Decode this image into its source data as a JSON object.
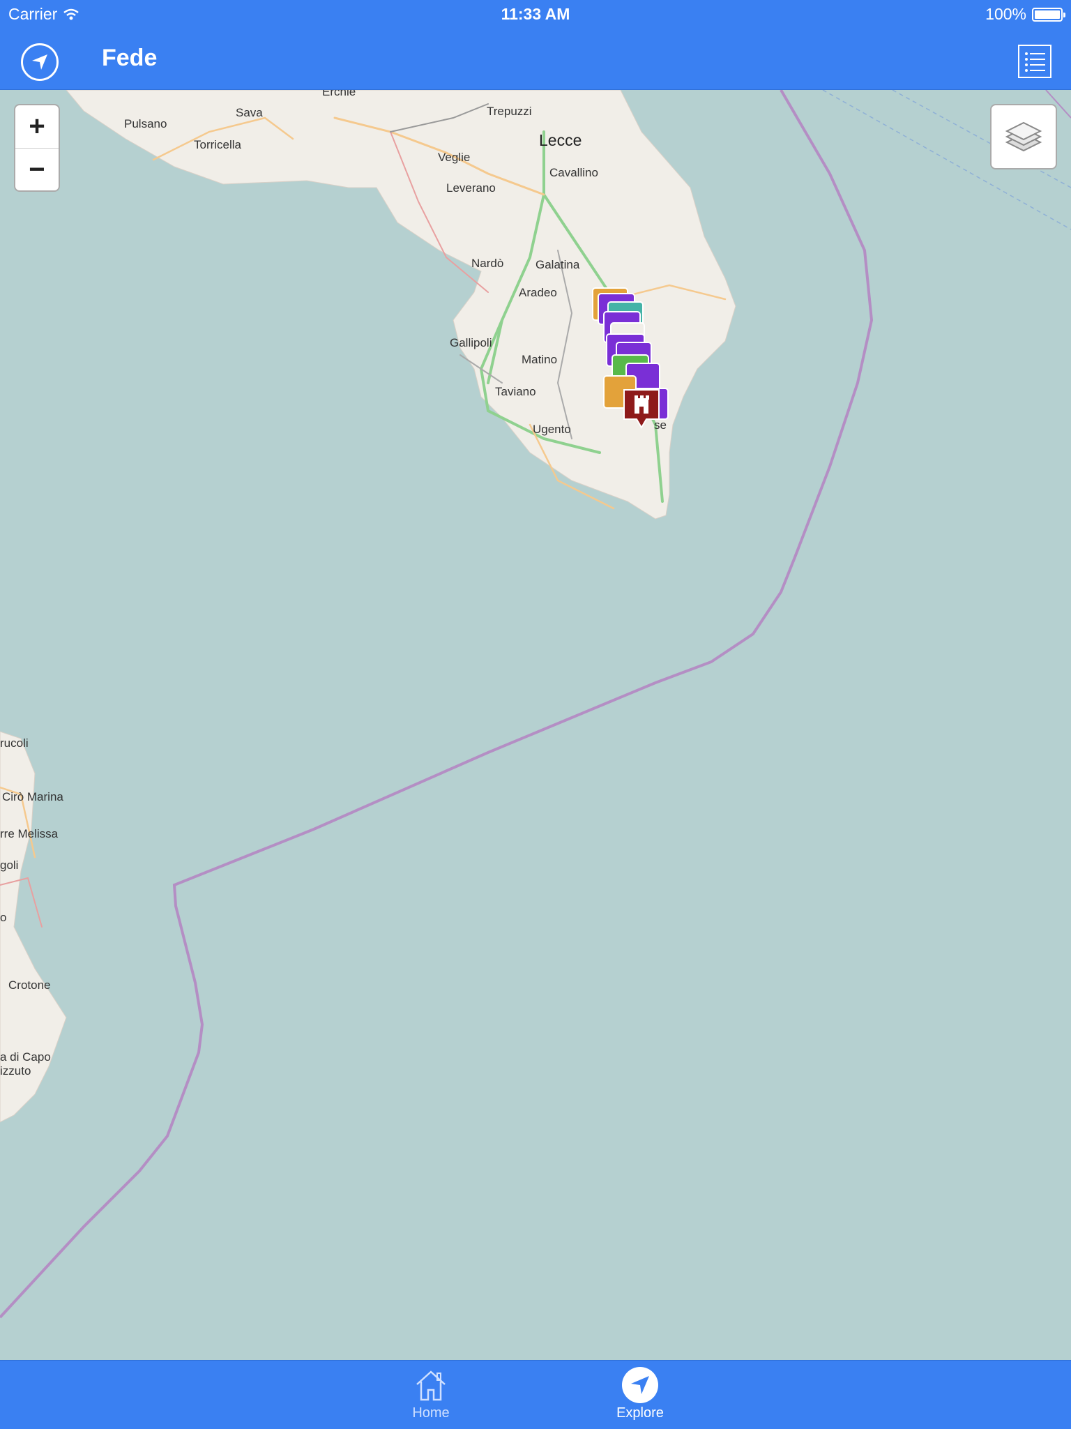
{
  "statusbar": {
    "carrier": "Carrier",
    "time": "11:33 AM",
    "battery": "100%"
  },
  "navbar": {
    "title": "Fede",
    "left_icon": "location-arrow-icon",
    "right_icon": "list-icon"
  },
  "map": {
    "zoom_in": "+",
    "zoom_out": "−",
    "layers_icon": "layers-icon",
    "colors": {
      "sea": "#b5d0d0",
      "land": "#f1eee8",
      "border": "#b48ec4",
      "road_green": "#8fd18f",
      "road_orange": "#f5c98e"
    },
    "place_labels": [
      "Erchie",
      "Sava",
      "Pulsano",
      "Torricella",
      "Trepuzzi",
      "Lecce",
      "Veglie",
      "Cavallino",
      "Leverano",
      "Nardò",
      "Galatina",
      "Aradeo",
      "Gallipoli",
      "Matino",
      "Taviano",
      "Ugento",
      "se",
      "rucoli",
      "Cirò Marina",
      "rre Melissa",
      "goli",
      "o",
      "Crotone",
      "a di Capo",
      "izzuto"
    ],
    "marker_colors": [
      "#7a2fd6",
      "#e3a23a",
      "#44b3a7",
      "#8e1a1a",
      "#58b94a"
    ]
  },
  "tabbar": {
    "tabs": [
      {
        "label": "Home",
        "icon": "home-icon",
        "active": false
      },
      {
        "label": "Explore",
        "icon": "compass-icon",
        "active": true
      }
    ]
  }
}
